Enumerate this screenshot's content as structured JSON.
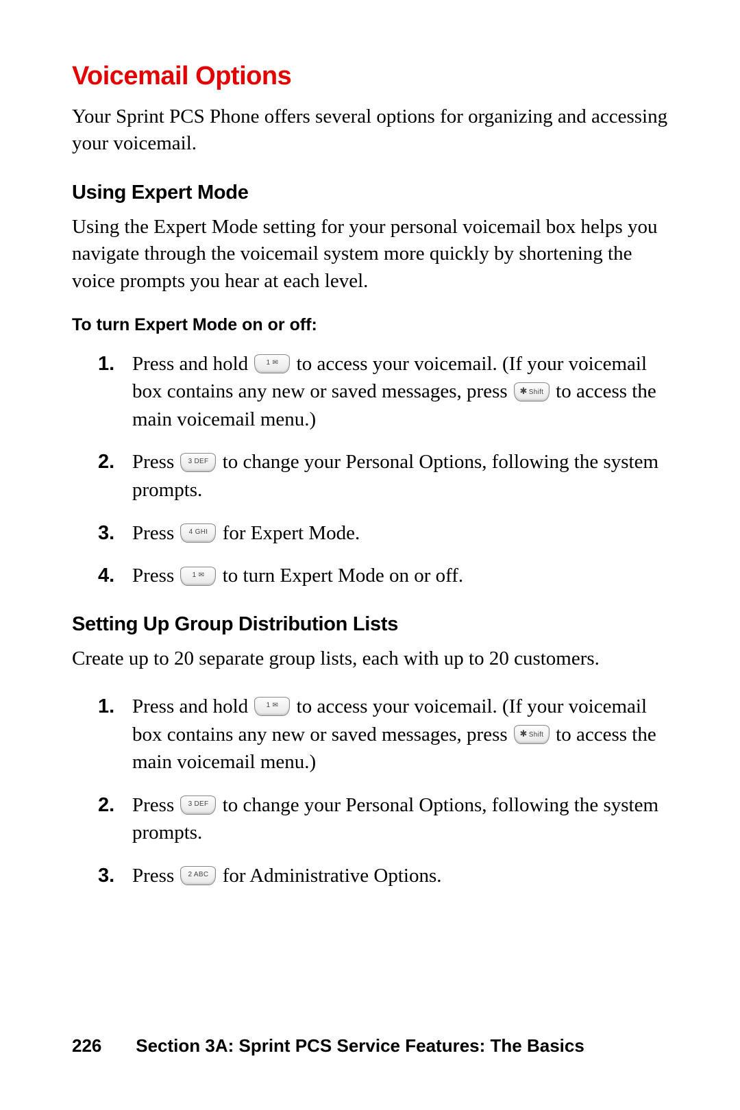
{
  "title": "Voicemail Options",
  "intro": "Your Sprint PCS Phone offers several options for organizing and accessing your voicemail.",
  "section1": {
    "heading": "Using Expert Mode",
    "body": "Using the Expert Mode setting for your personal voicemail box helps you navigate through the voicemail system more quickly by shortening the voice prompts you hear at each level.",
    "subhead": "To turn Expert Mode on or off:",
    "steps": {
      "s1a": "Press and hold ",
      "s1b": " to access your voicemail. (If your voicemail box contains any new or saved messages, press ",
      "s1c": " to access the main voicemail menu.)",
      "s2a": "Press ",
      "s2b": " to change your Personal Options, following the system prompts.",
      "s3a": "Press ",
      "s3b": " for Expert Mode.",
      "s4a": "Press ",
      "s4b": " to turn Expert Mode on or off."
    }
  },
  "section2": {
    "heading": "Setting Up Group Distribution Lists",
    "body": "Create up to 20 separate group lists, each with up to 20 customers.",
    "steps": {
      "s1a": "Press and hold ",
      "s1b": " to access your voicemail. (If your voicemail box contains any new or saved messages, press ",
      "s1c": " to access the main voicemail menu.)",
      "s2a": "Press ",
      "s2b": " to change your Personal Options, following the system prompts.",
      "s3a": "Press ",
      "s3b": " for Administrative Options."
    }
  },
  "nums": {
    "n1": "1.",
    "n2": "2.",
    "n3": "3.",
    "n4": "4."
  },
  "keys": {
    "one": "1 ✉",
    "star": "Shift",
    "three": "3 DEF",
    "four": "4 GHI",
    "two": "2 ABC"
  },
  "footer": {
    "page": "226",
    "text": "Section 3A: Sprint PCS Service Features: The Basics"
  }
}
